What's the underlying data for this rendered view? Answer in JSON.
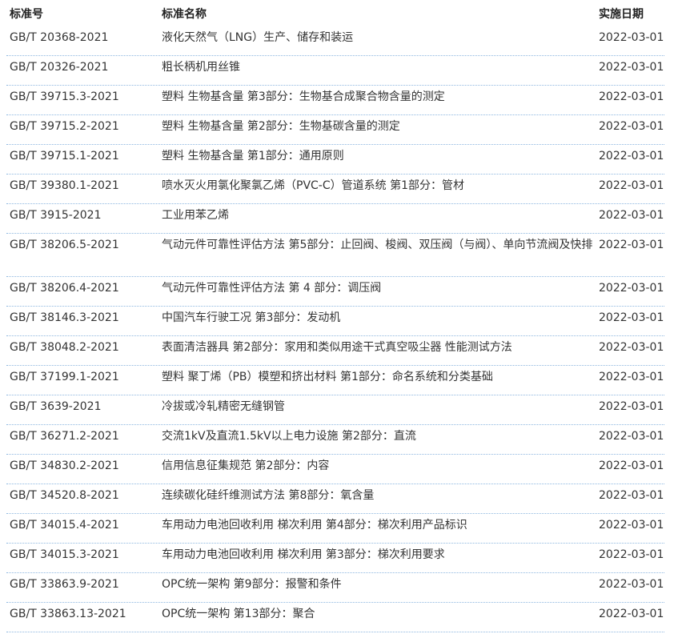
{
  "table": {
    "headers": {
      "code": "标准号",
      "name": "标准名称",
      "date": "实施日期"
    },
    "rows": [
      {
        "code": "GB/T 20368-2021",
        "name": "液化天然气（LNG）生产、储存和装运",
        "date": "2022-03-01"
      },
      {
        "code": "GB/T 20326-2021",
        "name": "粗长柄机用丝锥",
        "date": "2022-03-01"
      },
      {
        "code": "GB/T 39715.3-2021",
        "name": "塑料 生物基含量 第3部分：生物基合成聚合物含量的测定",
        "date": "2022-03-01"
      },
      {
        "code": "GB/T 39715.2-2021",
        "name": "塑料 生物基含量 第2部分：生物基碳含量的测定",
        "date": "2022-03-01"
      },
      {
        "code": "GB/T 39715.1-2021",
        "name": "塑料 生物基含量 第1部分：通用原则",
        "date": "2022-03-01"
      },
      {
        "code": "GB/T 39380.1-2021",
        "name": "喷水灭火用氯化聚氯乙烯（PVC-C）管道系统 第1部分：管材",
        "date": "2022-03-01"
      },
      {
        "code": "GB/T 3915-2021",
        "name": "工业用苯乙烯",
        "date": "2022-03-01"
      },
      {
        "code": "GB/T 38206.5-2021",
        "name": "气动元件可靠性评估方法 第5部分：止回阀、梭阀、双压阀（与阀）、单向节流阀及快排",
        "date": "2022-03-01"
      },
      {
        "code": "GB/T 38206.4-2021",
        "name": "气动元件可靠性评估方法 第 4 部分：调压阀",
        "date": "2022-03-01"
      },
      {
        "code": "GB/T 38146.3-2021",
        "name": "中国汽车行驶工况 第3部分：发动机",
        "date": "2022-03-01"
      },
      {
        "code": "GB/T 38048.2-2021",
        "name": "表面清洁器具 第2部分：家用和类似用途干式真空吸尘器 性能测试方法",
        "date": "2022-03-01"
      },
      {
        "code": "GB/T 37199.1-2021",
        "name": "塑料 聚丁烯（PB）模塑和挤出材料 第1部分：命名系统和分类基础",
        "date": "2022-03-01"
      },
      {
        "code": "GB/T 3639-2021",
        "name": "冷拔或冷轧精密无缝钢管",
        "date": "2022-03-01"
      },
      {
        "code": "GB/T 36271.2-2021",
        "name": "交流1kV及直流1.5kV以上电力设施 第2部分：直流",
        "date": "2022-03-01"
      },
      {
        "code": "GB/T 34830.2-2021",
        "name": "信用信息征集规范 第2部分：内容",
        "date": "2022-03-01"
      },
      {
        "code": "GB/T 34520.8-2021",
        "name": "连续碳化硅纤维测试方法 第8部分：氧含量",
        "date": "2022-03-01"
      },
      {
        "code": "GB/T 34015.4-2021",
        "name": "车用动力电池回收利用 梯次利用 第4部分：梯次利用产品标识",
        "date": "2022-03-01"
      },
      {
        "code": "GB/T 34015.3-2021",
        "name": "车用动力电池回收利用 梯次利用 第3部分：梯次利用要求",
        "date": "2022-03-01"
      },
      {
        "code": "GB/T 33863.9-2021",
        "name": "OPC统一架构 第9部分：报警和条件",
        "date": "2022-03-01"
      },
      {
        "code": "GB/T 33863.13-2021",
        "name": "OPC统一架构 第13部分：聚合",
        "date": "2022-03-01"
      }
    ]
  }
}
